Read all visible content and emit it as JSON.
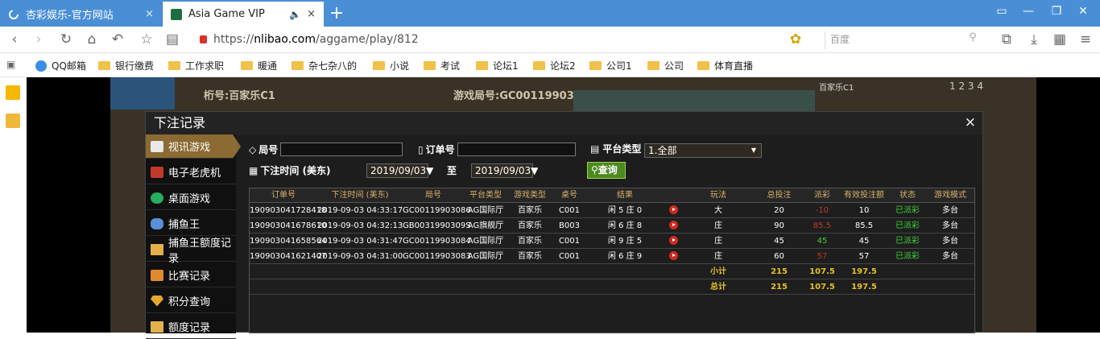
{
  "browser": {
    "tabs": [
      {
        "title": "杏彩娱乐-官方网站",
        "close": "×"
      },
      {
        "title": "Asia Game VIP",
        "close": "×"
      }
    ],
    "new_tab": "+",
    "url_prefix": "https://",
    "url_domain": "nlibao.com",
    "url_path": "/aggame/play/812",
    "search_placeholder": "百度"
  },
  "bookmarks": [
    {
      "label": "QQ邮箱",
      "type": "site"
    },
    {
      "label": "银行缴费",
      "type": "folder"
    },
    {
      "label": "工作求职",
      "type": "folder"
    },
    {
      "label": "暖通",
      "type": "folder"
    },
    {
      "label": "杂七杂八的",
      "type": "folder"
    },
    {
      "label": "小说",
      "type": "folder"
    },
    {
      "label": "考试",
      "type": "folder"
    },
    {
      "label": "论坛1",
      "type": "folder"
    },
    {
      "label": "论坛2",
      "type": "folder"
    },
    {
      "label": "公司1",
      "type": "folder"
    },
    {
      "label": "公司",
      "type": "folder"
    },
    {
      "label": "体育直播",
      "type": "folder"
    }
  ],
  "game": {
    "table_label": "桁号:百家乐C1",
    "round_label": "游戏局号:GC00119903086",
    "right_label": "百家乐C1",
    "right_nums": "1 2 3 4"
  },
  "dialog": {
    "title": "下注记录",
    "close": "×",
    "menu": [
      {
        "label": "视讯游戏",
        "active": true
      },
      {
        "label": "电子老虎机",
        "active": false
      },
      {
        "label": "桌面游戏",
        "active": false
      },
      {
        "label": "捕鱼王",
        "active": false
      },
      {
        "label": "捕鱼王额度记录",
        "active": false
      },
      {
        "label": "比赛记录",
        "active": false
      },
      {
        "label": "积分查询",
        "active": false
      },
      {
        "label": "额度记录",
        "active": false
      }
    ],
    "filters": {
      "round_label": "局号",
      "order_label": "订单号",
      "platform_label": "平台类型",
      "platform_value": "1.全部",
      "time_label": "下注时间 (美东)",
      "date_from": "2019/09/03▼",
      "to_label": "至",
      "date_to": "2019/09/03▼",
      "query_button": "查询"
    },
    "columns": [
      "订单号",
      "下注时间 (美东)",
      "局号",
      "平台类型",
      "游戏类型",
      "桌号",
      "结果",
      "",
      "玩法",
      "总投注",
      "派彩",
      "有效投注额",
      "状态",
      "游戏模式"
    ],
    "rows": [
      {
        "order": "190903041728418",
        "time": "2019-09-03 04:33:17",
        "round": "GC00119903086",
        "platform": "AG国际厅",
        "game": "百家乐",
        "table": "C001",
        "result": "闲 5 庄 0",
        "play": "大",
        "bet": "20",
        "payout": "-10",
        "payout_color": "#c0392b",
        "valid": "10",
        "status": "已派彩",
        "mode": "多台"
      },
      {
        "order": "190903041678610",
        "time": "2019-09-03 04:32:13",
        "round": "GB0031990309S",
        "platform": "AG旗舰厅",
        "game": "百家乐",
        "table": "B003",
        "result": "闲 6 庄 8",
        "play": "庄",
        "bet": "90",
        "payout": "85.5",
        "payout_color": "#c0392b",
        "valid": "85.5",
        "status": "已派彩",
        "mode": "多台"
      },
      {
        "order": "190903041658564",
        "time": "2019-09-03 04:31:47",
        "round": "GC00119903084",
        "platform": "AG国际厅",
        "game": "百家乐",
        "table": "C001",
        "result": "闲 9 庄 5",
        "play": "庄",
        "bet": "45",
        "payout": "45",
        "payout_color": "#3fd13f",
        "valid": "45",
        "status": "已派彩",
        "mode": "多台"
      },
      {
        "order": "190903041621407",
        "time": "2019-09-03 04:31:00",
        "round": "GC00119903083",
        "platform": "AG国际厅",
        "game": "百家乐",
        "table": "C001",
        "result": "闲 6 庄 9",
        "play": "庄",
        "bet": "60",
        "payout": "57",
        "payout_color": "#c0392b",
        "valid": "57",
        "status": "已派彩",
        "mode": "多台"
      }
    ],
    "subtotal": {
      "label": "小计",
      "bet": "215",
      "payout": "107.5",
      "valid": "197.5"
    },
    "total": {
      "label": "总计",
      "bet": "215",
      "payout": "107.5",
      "valid": "197.5"
    },
    "colors": {
      "status_green": "#3fd13f",
      "header_gold": "#d7b36a",
      "sum_yellow": "#e3c12a",
      "menu_active": "#8b6a33"
    }
  }
}
